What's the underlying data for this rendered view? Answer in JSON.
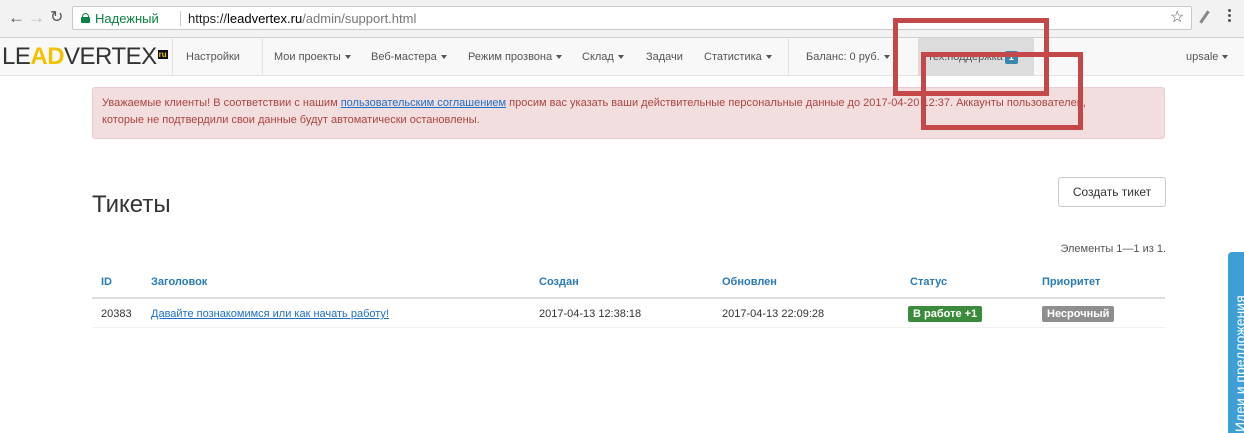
{
  "browser": {
    "secure_label": "Надежный",
    "url_scheme": "https://",
    "url_host": "leadvertex.ru",
    "url_path": "/admin/support.html",
    "icons": [
      "back-icon",
      "forward-icon",
      "reload-icon",
      "lock-icon",
      "star-icon",
      "extension-icon",
      "menu-icon"
    ]
  },
  "navbar": {
    "logo": {
      "le": "LE",
      "ad": "AD",
      "rt": "VERTEX",
      "ru": "ru"
    },
    "items": [
      {
        "label": "Настройки",
        "dropdown": false
      },
      {
        "label": "Мои проекты",
        "dropdown": true
      },
      {
        "label": "Веб-мастера",
        "dropdown": true
      },
      {
        "label": "Режим прозвона",
        "dropdown": true
      },
      {
        "label": "Склад",
        "dropdown": true
      },
      {
        "label": "Задачи",
        "dropdown": false
      },
      {
        "label": "Статистика",
        "dropdown": true
      },
      {
        "label": "Баланс: 0 руб.",
        "dropdown": true
      },
      {
        "label": "тех.поддержка",
        "badge": "1",
        "active": true
      },
      {
        "label": "upsale",
        "dropdown": true
      }
    ]
  },
  "alert": {
    "text_before": "Уважаемые клиенты! В соответствии с нашим ",
    "link": "пользовательским соглашением",
    "text_after": " просим вас указать ваши действительные персональные данные до 2017-04-20 12:37. Аккаунты пользователей,",
    "line2": "которые не подтвердили свои данные будут автоматически остановлены."
  },
  "page": {
    "title": "Тикеты",
    "create_button": "Создать тикет",
    "summary": "Элементы 1—1 из 1."
  },
  "table": {
    "headers": [
      "ID",
      "Заголовок",
      "Создан",
      "Обновлен",
      "Статус",
      "Приоритет"
    ],
    "rows": [
      {
        "id": "20383",
        "title": "Давайте познакомимся или как начать работу!",
        "created": "2017-04-13 12:38:18",
        "updated": "2017-04-13 22:09:28",
        "status": "В работе +1",
        "priority": "Несрочный"
      }
    ]
  },
  "side_tab": {
    "label": "Идеи и предложения"
  },
  "colors": {
    "brand_yellow": "#f2c200",
    "link": "#1f6ec7",
    "header": "#2a7ab8",
    "status_success": "#3c8b3c",
    "status_default": "#8e8e8e",
    "alert_bg": "#f2dede",
    "alert_text": "#a94442",
    "annotation": "#c44849",
    "side_tab": "#3d9fd5"
  }
}
